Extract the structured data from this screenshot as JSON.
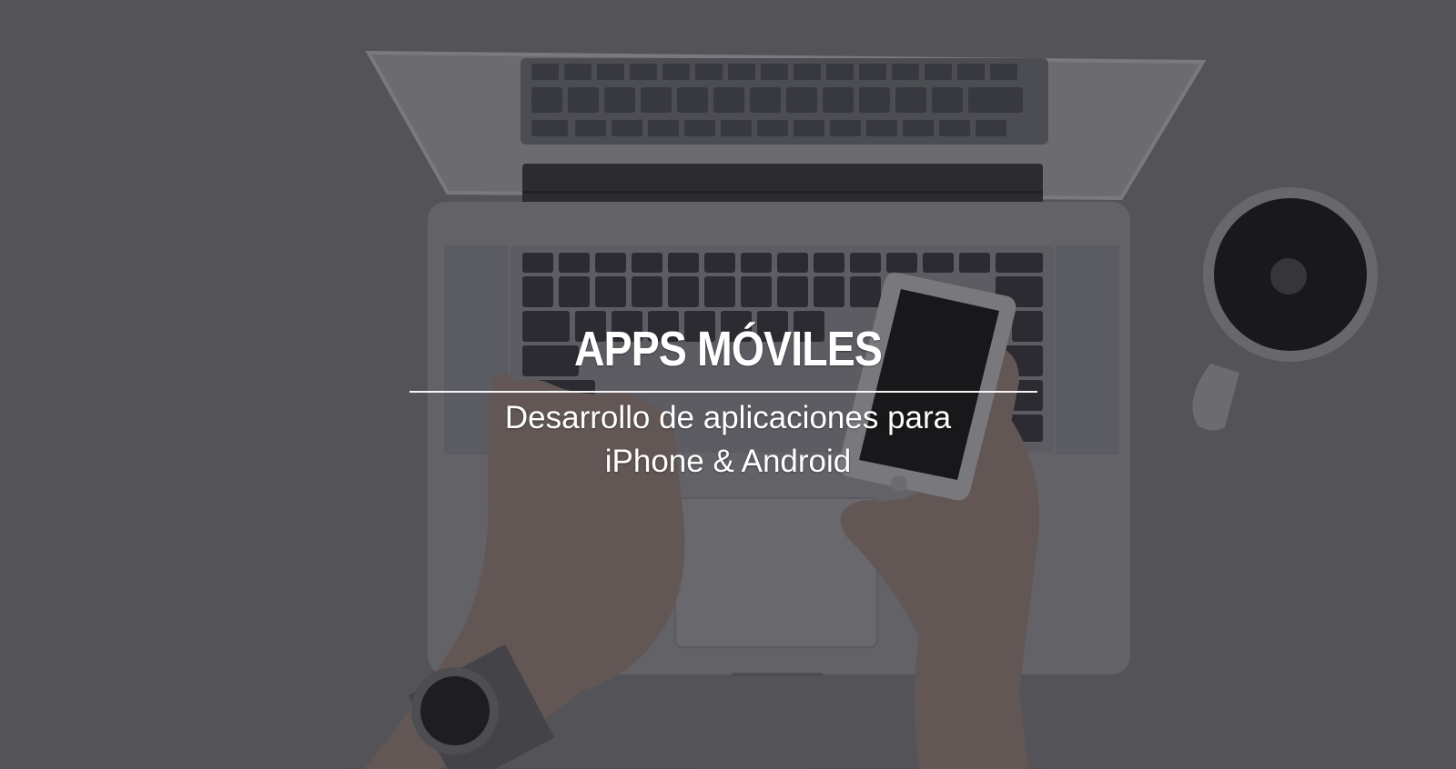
{
  "hero": {
    "title": "APPS MÓVILES",
    "subtitle_line1": "Desarrollo de aplicaciones para",
    "subtitle_line2": "iPhone & Android"
  },
  "colors": {
    "background": "#5d5d61",
    "text": "#ffffff"
  },
  "icons": [
    "laptop-illustration",
    "smartphone-illustration",
    "coffee-cup-illustration",
    "wristwatch-illustration"
  ]
}
